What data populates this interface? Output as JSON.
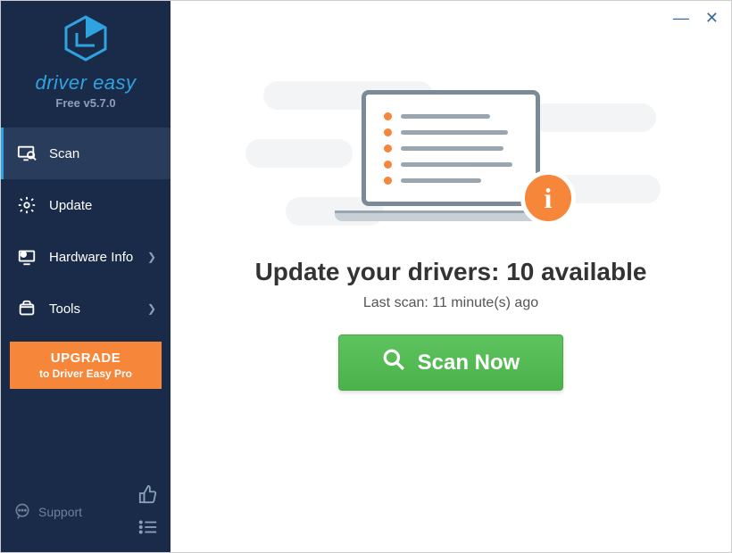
{
  "brand": {
    "name": "driver easy",
    "version": "Free v5.7.0"
  },
  "sidebar": {
    "items": [
      {
        "label": "Scan",
        "has_chevron": false,
        "active": true
      },
      {
        "label": "Update",
        "has_chevron": false,
        "active": false
      },
      {
        "label": "Hardware Info",
        "has_chevron": true,
        "active": false
      },
      {
        "label": "Tools",
        "has_chevron": true,
        "active": false
      }
    ],
    "upgrade": {
      "line1": "UPGRADE",
      "line2": "to Driver Easy Pro"
    },
    "support_label": "Support"
  },
  "main": {
    "headline": "Update your drivers: 10 available",
    "subline": "Last scan: 11 minute(s) ago",
    "scan_button_label": "Scan Now",
    "available_count": 10,
    "last_scan_minutes": 11
  },
  "colors": {
    "sidebar_bg": "#1a2b4a",
    "accent_blue": "#2fa3e0",
    "accent_orange": "#f6863a",
    "scan_green": "#4bb24b"
  }
}
